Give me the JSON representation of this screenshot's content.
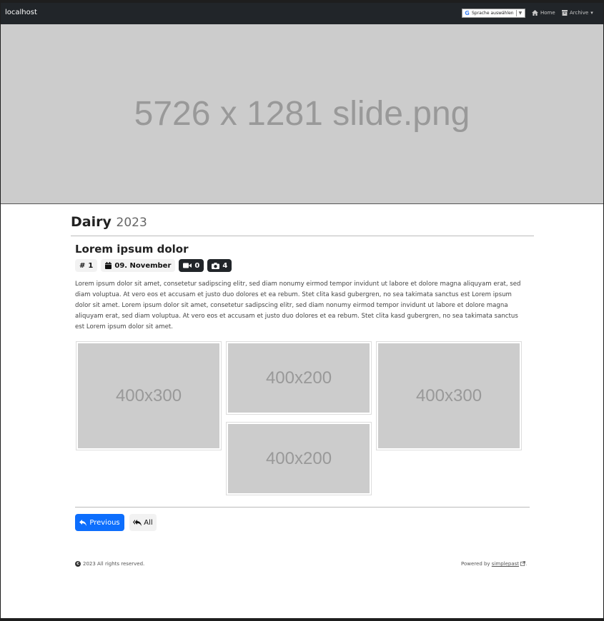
{
  "topbar": {
    "brand": "localhost",
    "translate_label": "Sprache auswählen",
    "translate_arrow": "▼",
    "home_label": "Home",
    "archive_label": "Archive",
    "archive_caret": "▾"
  },
  "hero": {
    "placeholder": "5726 x 1281 slide.png"
  },
  "page": {
    "title": "Dairy",
    "year": "2023"
  },
  "post": {
    "title": "Lorem ipsum dolor",
    "badges": {
      "number": "1",
      "date": "09. November",
      "videos": "0",
      "photos": "4"
    },
    "body": "Lorem ipsum dolor sit amet, consetetur sadipscing elitr, sed diam nonumy eirmod tempor invidunt ut labore et dolore magna aliquyam erat, sed diam voluptua. At vero eos et accusam et justo duo dolores et ea rebum. Stet clita kasd gubergren, no sea takimata sanctus est Lorem ipsum dolor sit amet. Lorem ipsum dolor sit amet, consetetur sadipscing elitr, sed diam nonumy eirmod tempor invidunt ut labore et dolore magna aliquyam erat, sed diam voluptua. At vero eos et accusam et justo duo dolores et ea rebum. Stet clita kasd gubergren, no sea takimata sanctus est Lorem ipsum dolor sit amet.",
    "images": [
      "400x300",
      "400x200",
      "400x200",
      "400x300"
    ]
  },
  "nav": {
    "previous": "Previous",
    "all": "All"
  },
  "footer": {
    "copyright": "2023 All rights reserved.",
    "powered_prefix": "Powered by ",
    "powered_link": "simplepast",
    "powered_suffix": "."
  }
}
